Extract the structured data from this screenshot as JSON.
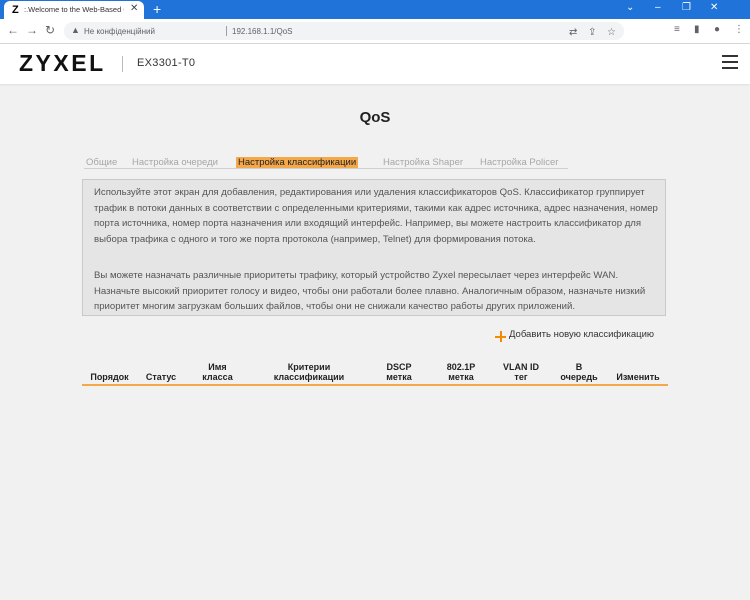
{
  "browser": {
    "tab_favicon": "Z",
    "tab_title": ":.Welcome to the Web-Based Co",
    "tab_close": "✕",
    "new_tab": "+",
    "omnibox": {
      "security_label": "Не конфіденційний",
      "url": "192.168.1.1/QoS"
    }
  },
  "header": {
    "logo": "ZYXEL",
    "model": "EX3301-T0"
  },
  "page": {
    "title": "QoS",
    "tabs": [
      {
        "label": "Общие"
      },
      {
        "label": "Настройка очереди"
      },
      {
        "label": "Настройка классификации",
        "active": true
      },
      {
        "label": "Настройка Shaper"
      },
      {
        "label": "Настройка Policer"
      }
    ],
    "description": [
      "Используйте этот экран для добавления, редактирования или удаления классификаторов QoS. Классификатор группирует трафик в потоки данных в соответствии с определенными критериями, такими как адрес источника, адрес назначения, номер порта источника, номер порта назначения или входящий интерфейс. Например, вы можете настроить классификатор для выбора трафика с одного и того же порта протокола (например, Telnet) для формирования потока.",
      "Вы можете назначать различные приоритеты трафику, который устройство Zyxel пересылает через интерфейс WAN. Назначьте высокий приоритет голосу и видео, чтобы они работали более плавно. Аналогичным образом, назначьте низкий приоритет многим загрузкам больших файлов, чтобы они не снижали качество работы других приложений."
    ],
    "add_label": "Добавить новую классификацию",
    "table_headers": [
      "Порядок",
      "Статус",
      "Имя\nкласса",
      "Критерии\nклассификации",
      "DSCP\nметка",
      "802.1P\nметка",
      "VLAN ID\nтег",
      "В\nочередь",
      "Изменить"
    ]
  },
  "colors": {
    "browser_blue": "#1f73d9",
    "accent_orange": "#f5a84a",
    "plus_orange": "#f08c00"
  }
}
